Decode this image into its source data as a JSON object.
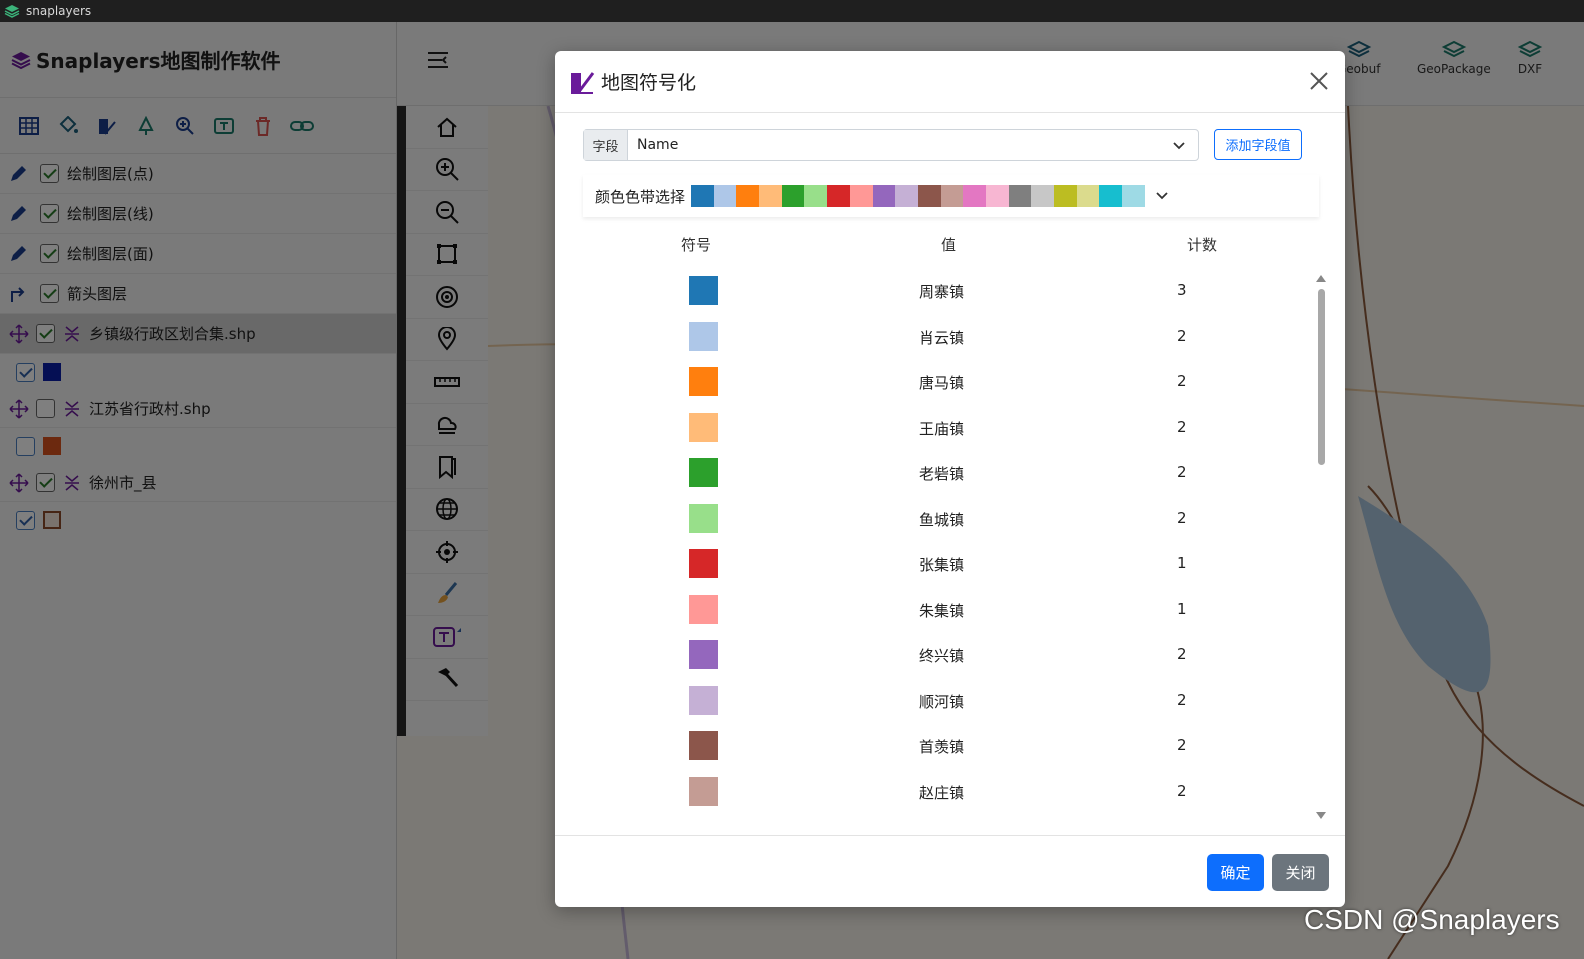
{
  "titlebar": {
    "title": "snaplayers"
  },
  "app": {
    "title": "Snaplayers地图制作软件"
  },
  "layers": [
    {
      "name": "绘制图层(点)",
      "checked": true
    },
    {
      "name": "绘制图层(线)",
      "checked": true
    },
    {
      "name": "绘制图层(面)",
      "checked": true
    },
    {
      "name": "箭头图层",
      "checked": true
    },
    {
      "name": "乡镇级行政区划合集.shp",
      "checked": true,
      "symbol_color": "#0b1fa8"
    },
    {
      "name": "江苏省行政村.shp",
      "checked": false,
      "symbol_color": "#d9531e"
    },
    {
      "name": "徐州市_县",
      "checked": true,
      "symbol_color": "#f5e6dd"
    }
  ],
  "ribbon": {
    "items": [
      "Geobuf",
      "GeoPackage",
      "DXF"
    ]
  },
  "modal": {
    "title": "地图符号化",
    "field_label": "字段",
    "field_value": "Name",
    "add_button": "添加字段值",
    "ramp_label": "颜色色带选择",
    "ramp_colors": [
      "#1f77b4",
      "#aec7e8",
      "#ff7f0e",
      "#ffbb78",
      "#2ca02c",
      "#98df8a",
      "#d62728",
      "#ff9896",
      "#9467bd",
      "#c5b0d5",
      "#8c564b",
      "#c49c94",
      "#e377c2",
      "#f7b6d2",
      "#7f7f7f",
      "#c7c7c7",
      "#bcbd22",
      "#dbdb8d",
      "#17becf",
      "#9edae5"
    ],
    "columns": {
      "symbol": "符号",
      "value": "值",
      "count": "计数"
    },
    "rows": [
      {
        "color": "#1f77b4",
        "value": "周寨镇",
        "count": "3"
      },
      {
        "color": "#aec7e8",
        "value": "肖云镇",
        "count": "2"
      },
      {
        "color": "#ff7f0e",
        "value": "唐马镇",
        "count": "2"
      },
      {
        "color": "#ffbb78",
        "value": "王庙镇",
        "count": "2"
      },
      {
        "color": "#2ca02c",
        "value": "老砦镇",
        "count": "2"
      },
      {
        "color": "#98df8a",
        "value": "鱼城镇",
        "count": "2"
      },
      {
        "color": "#d62728",
        "value": "张集镇",
        "count": "1"
      },
      {
        "color": "#ff9896",
        "value": "朱集镇",
        "count": "1"
      },
      {
        "color": "#9467bd",
        "value": "终兴镇",
        "count": "2"
      },
      {
        "color": "#c5b0d5",
        "value": "顺河镇",
        "count": "2"
      },
      {
        "color": "#8c564b",
        "value": "首羡镇",
        "count": "2"
      },
      {
        "color": "#c49c94",
        "value": "赵庄镇",
        "count": "2"
      }
    ],
    "ok_button": "确定",
    "close_button": "关闭"
  },
  "watermark": "CSDN @Snaplayers"
}
